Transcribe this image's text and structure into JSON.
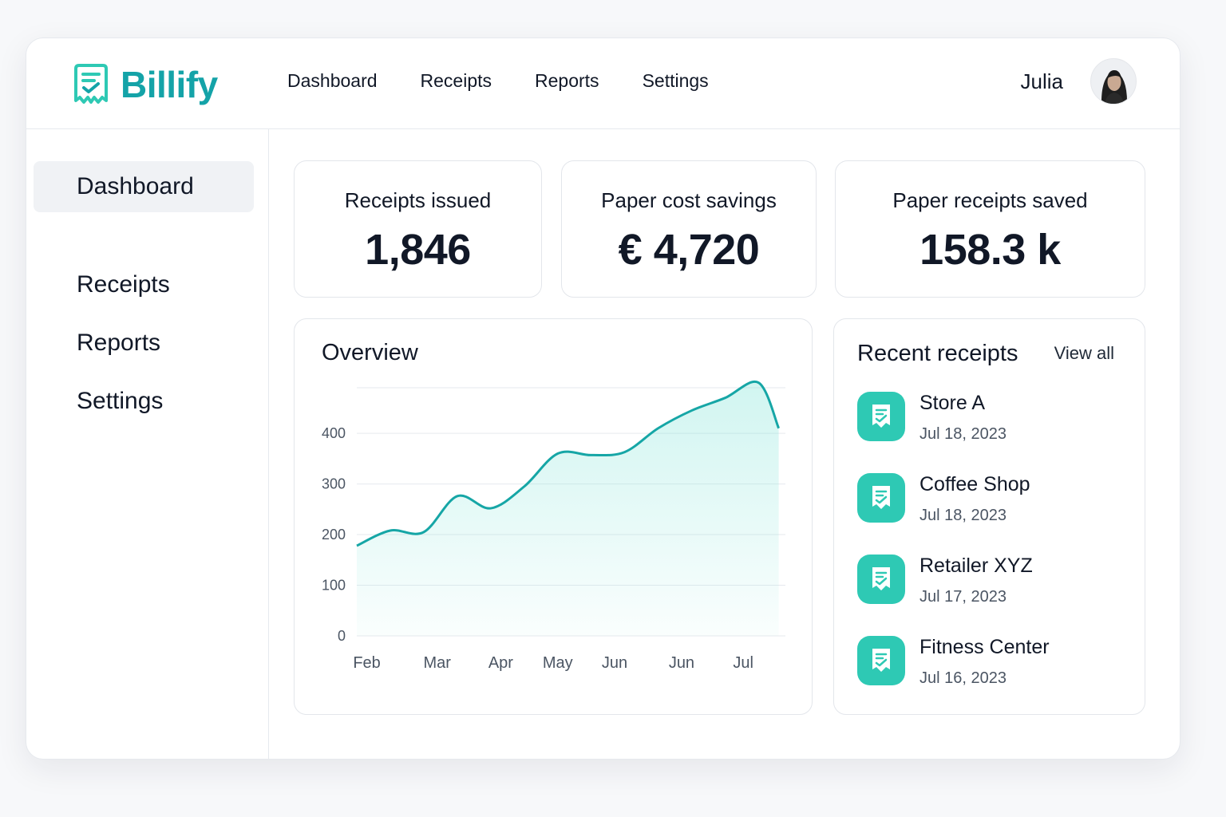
{
  "app": {
    "name": "Billify",
    "brand_color": "#14a3a8",
    "accent_color": "#2ec9b4",
    "logo_icon": "receipt-check-icon"
  },
  "topnav": {
    "items": [
      {
        "label": "Dashboard"
      },
      {
        "label": "Receipts"
      },
      {
        "label": "Reports"
      },
      {
        "label": "Settings"
      }
    ]
  },
  "user": {
    "name": "Julia",
    "avatar_icon": "user-avatar"
  },
  "sidebar": {
    "items": [
      {
        "label": "Dashboard",
        "active": true
      },
      {
        "label": "Receipts",
        "active": false
      },
      {
        "label": "Reports",
        "active": false
      },
      {
        "label": "Settings",
        "active": false
      }
    ]
  },
  "stats": [
    {
      "label": "Receipts issued",
      "value": "1,846"
    },
    {
      "label": "Paper cost savings",
      "value": "€ 4,720"
    },
    {
      "label": "Paper receipts saved",
      "value": "158.3 k"
    }
  ],
  "overview": {
    "title": "Overview"
  },
  "chart_data": {
    "type": "area",
    "title": "Overview",
    "xlabel": "",
    "ylabel": "",
    "x_tick_labels": [
      "Feb",
      "Mar",
      "Apr",
      "May",
      "Jun",
      "Jun",
      "Jul"
    ],
    "y_ticks": [
      0,
      100,
      200,
      300,
      400
    ],
    "ylim": [
      0,
      490
    ],
    "grid": true,
    "line_color": "#16a6a6",
    "series": [
      {
        "x": [
          0,
          0.5,
          1,
          1.5,
          2,
          2.5,
          3,
          3.5,
          4,
          4.5,
          5,
          5.5,
          6,
          6.3
        ],
        "values": [
          178,
          208,
          205,
          276,
          252,
          295,
          360,
          357,
          363,
          410,
          445,
          470,
          500,
          410
        ]
      }
    ]
  },
  "recent": {
    "title": "Recent receipts",
    "view_all": "View all",
    "icon": "receipt-check-icon",
    "items": [
      {
        "name": "Store A",
        "date": "Jul 18, 2023"
      },
      {
        "name": "Coffee Shop",
        "date": "Jul 18, 2023"
      },
      {
        "name": "Retailer XYZ",
        "date": "Jul 17, 2023"
      },
      {
        "name": "Fitness Center",
        "date": "Jul 16, 2023"
      }
    ]
  }
}
